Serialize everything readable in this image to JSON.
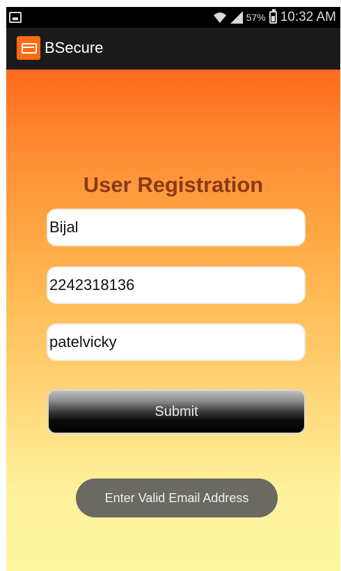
{
  "status_bar": {
    "battery_percent": "57%",
    "time": "10:32 AM",
    "icons": [
      "gallery-notification-icon",
      "wifi-icon",
      "signal-icon",
      "battery-charging-icon"
    ]
  },
  "action_bar": {
    "app_title": "BSecure",
    "app_icon": "app-logo-icon"
  },
  "form": {
    "title": "User Registration",
    "fields": [
      {
        "value": "Bijal"
      },
      {
        "value": "2242318136"
      },
      {
        "value": "patelvicky"
      }
    ],
    "submit_label": "Submit"
  },
  "toast": {
    "message": "Enter Valid Email Address"
  },
  "colors": {
    "gradient_top": "#ff6a1c",
    "gradient_bottom": "#fff59e",
    "title_color": "#8a3a14",
    "action_bar": "#1b1b1b",
    "toast_bg": "#6a6962"
  }
}
